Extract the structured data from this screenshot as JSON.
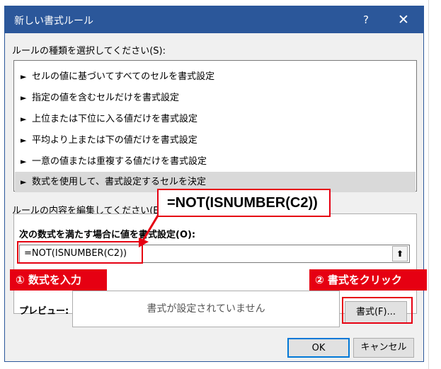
{
  "dialog": {
    "title": "新しい書式ルール",
    "help_label": "?",
    "close_label": "✕",
    "select_rule_label": "ルールの種類を選択してください(S):",
    "rule_types": [
      {
        "label": "セルの値に基づいてすべてのセルを書式設定",
        "selected": false
      },
      {
        "label": "指定の値を含むセルだけを書式設定",
        "selected": false
      },
      {
        "label": "上位または下位に入る値だけを書式設定",
        "selected": false
      },
      {
        "label": "平均より上または下の値だけを書式設定",
        "selected": false
      },
      {
        "label": "一意の値または重複する値だけを書式設定",
        "selected": false
      },
      {
        "label": "数式を使用して、書式設定するセルを決定",
        "selected": true
      }
    ],
    "edit_rule_label": "ルールの内容を編集してください(E):",
    "formula_label": "次の数式を満たす場合に値を書式設定(O):",
    "formula_value": "=NOT(ISNUMBER(C2))",
    "collapse_icon": "⬆",
    "preview_label": "プレビュー:",
    "preview_text": "書式が設定されていません",
    "format_button": "書式(F)...",
    "ok_button": "OK",
    "cancel_button": "キャンセル"
  },
  "annotations": {
    "formula_callout": "=NOT(ISNUMBER(C2))",
    "step1": "① 数式を入力",
    "step2": "② 書式をクリック",
    "accent_color": "#e60012"
  },
  "colors": {
    "titlebar": "#2b579a",
    "dialog_bg": "#f0f0f0",
    "selected_row": "#d9d9d9"
  }
}
